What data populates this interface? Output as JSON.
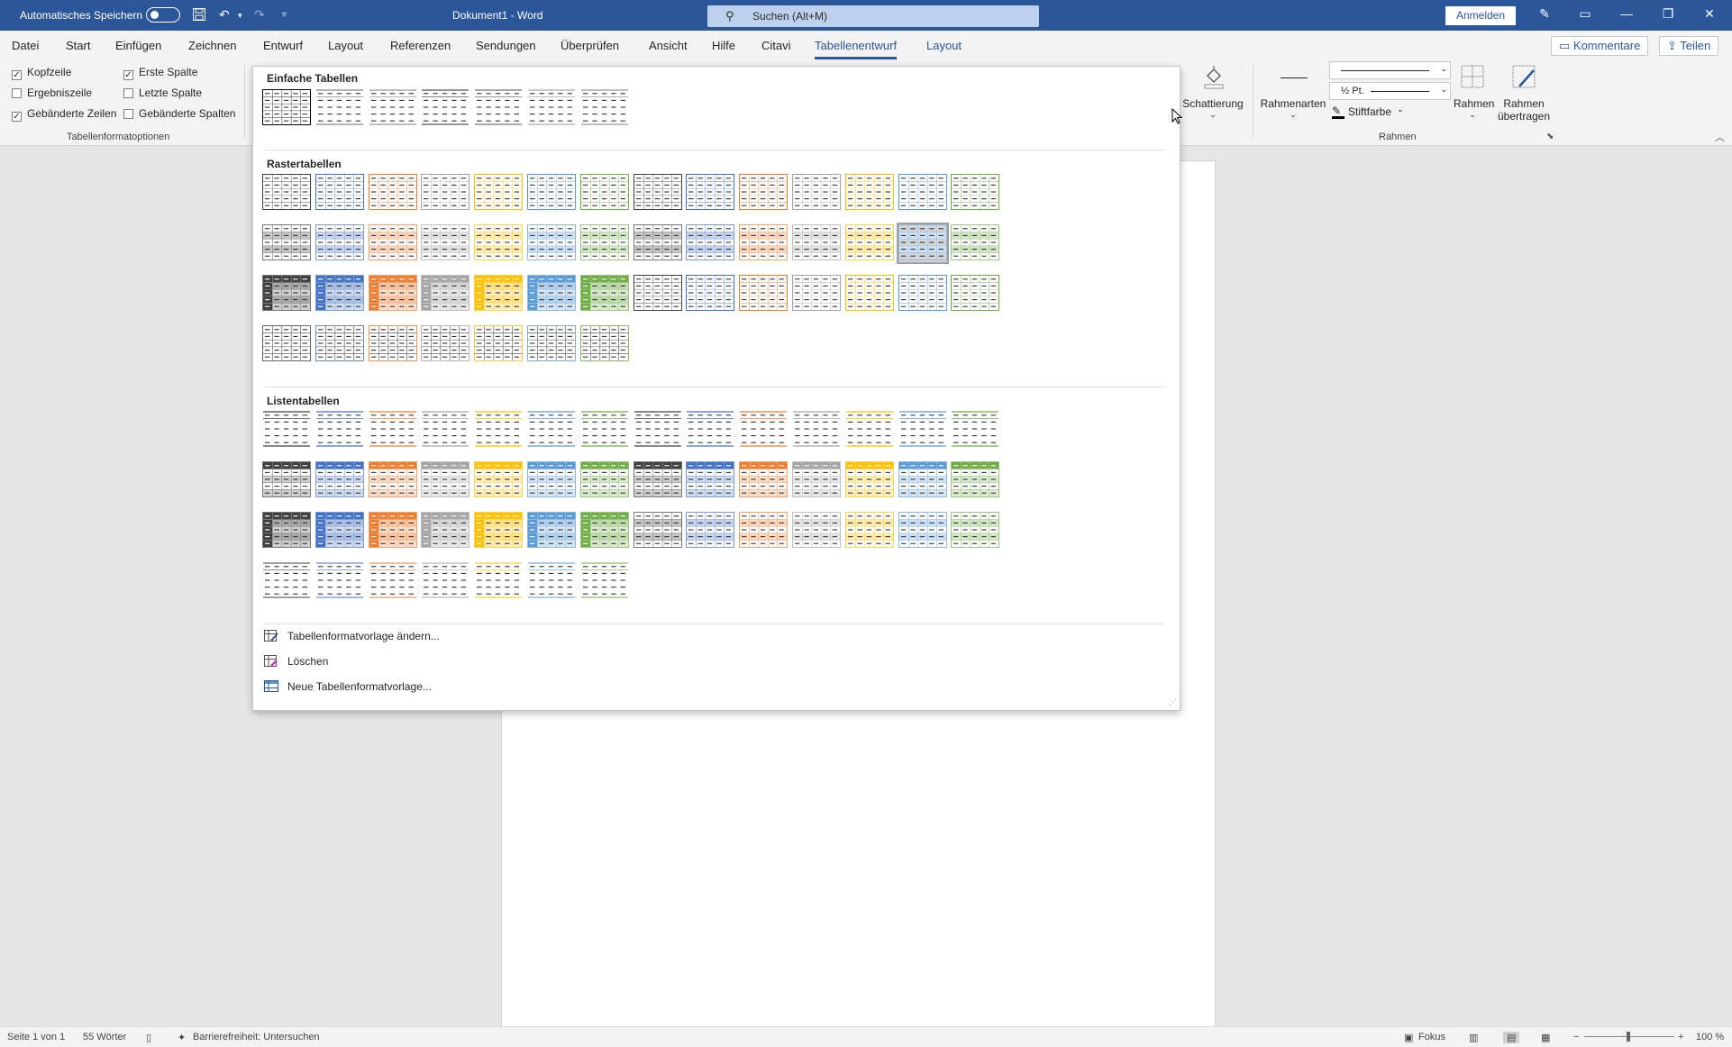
{
  "titlebar": {
    "autosave_label": "Automatisches Speichern",
    "title": "Dokument1  -  Word",
    "search_placeholder": "Suchen (Alt+M)",
    "signin_label": "Anmelden"
  },
  "menu": {
    "tabs": [
      "Datei",
      "Start",
      "Einfügen",
      "Zeichnen",
      "Entwurf",
      "Layout",
      "Referenzen",
      "Sendungen",
      "Überprüfen",
      "Ansicht",
      "Hilfe",
      "Citavi",
      "Tabellenentwurf",
      "Layout"
    ],
    "active_tab": "Tabellenentwurf",
    "comments_label": "Kommentare",
    "share_label": "Teilen"
  },
  "ribbon": {
    "table_style_options": {
      "group_label": "Tabellenformatoptionen",
      "checkboxes": [
        {
          "label": "Kopfzeile",
          "checked": true
        },
        {
          "label": "Ergebniszeile",
          "checked": false
        },
        {
          "label": "Gebänderte Zeilen",
          "checked": true
        },
        {
          "label": "Erste Spalte",
          "checked": true
        },
        {
          "label": "Letzte Spalte",
          "checked": false
        },
        {
          "label": "Gebänderte Spalten",
          "checked": false
        }
      ]
    },
    "shading_label": "Schattierung",
    "border_styles_label": "Rahmenarten",
    "pen_weight": "½ Pt.",
    "pen_color_label": "Stiftfarbe",
    "borders_label": "Rahmen",
    "border_painter_label_1": "Rahmen",
    "border_painter_label_2": "übertragen",
    "borders_group_label": "Rahmen"
  },
  "gallery": {
    "sections": [
      {
        "title": "Einfache Tabellen"
      },
      {
        "title": "Rastertabellen"
      },
      {
        "title": "Listentabellen"
      }
    ],
    "actions": [
      {
        "label": "Tabellenformatvorlage ändern..."
      },
      {
        "label": "Löschen"
      },
      {
        "label": "Neue Tabellenformatvorlage..."
      }
    ],
    "palette": [
      "#404040",
      "#4472c4",
      "#ed7d31",
      "#a5a5a5",
      "#ffc000",
      "#5b9bd5",
      "#70ad47"
    ]
  },
  "statusbar": {
    "page": "Seite 1 von 1",
    "words": "55 Wörter",
    "accessibility": "Barrierefreiheit: Untersuchen",
    "focus": "Fokus",
    "zoom": "100 %"
  }
}
